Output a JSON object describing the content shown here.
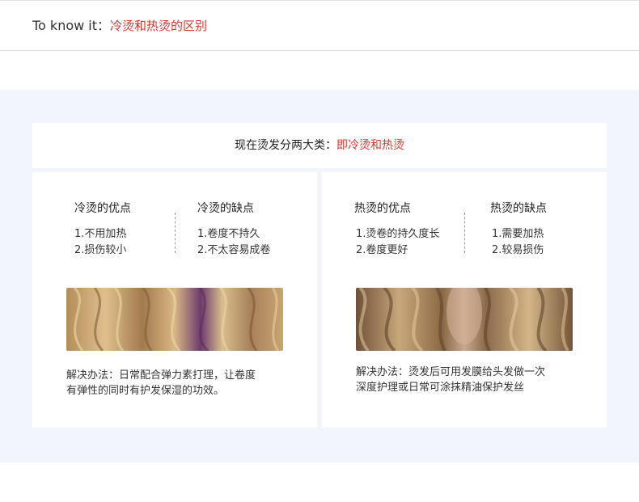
{
  "header": {
    "prefix": "To know it：",
    "topic": "冷烫和热烫的区别"
  },
  "intro": {
    "text": "现在烫发分两大类：",
    "highlight": "即冷烫和热烫"
  },
  "cold": {
    "pros_title": "冷烫的优点",
    "pros": [
      "1.不用加热",
      "2.损伤较小"
    ],
    "cons_title": "冷烫的缺点",
    "cons": [
      "1.卷度不持久",
      "2.不太容易成卷"
    ],
    "solution_line1": "解决办法：日常配合弹力素打理，让卷度",
    "solution_line2": "有弹性的同时有护发保湿的功效。"
  },
  "hot": {
    "pros_title": "热烫的优点",
    "pros": [
      "1.烫卷的持久度长",
      "2.卷度更好"
    ],
    "cons_title": "热烫的缺点",
    "cons": [
      "1.需要加热",
      "2.较易损伤"
    ],
    "solution_line1": "解决办法：烫发后可用发膜给头发做一次",
    "solution_line2": "深度护理或日常可涂抹精油保护发丝"
  },
  "colors": {
    "accent": "#d9362c",
    "band": "#f3f5fc"
  }
}
